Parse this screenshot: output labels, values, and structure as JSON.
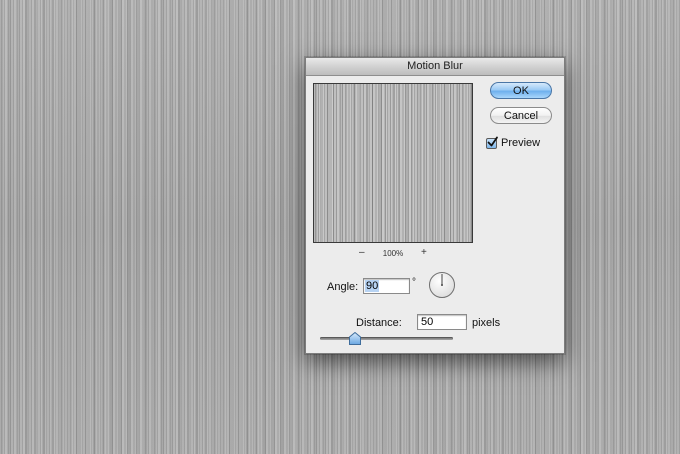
{
  "dialog": {
    "title": "Motion Blur",
    "ok_label": "OK",
    "cancel_label": "Cancel",
    "preview_label": "Preview",
    "preview_checked": true
  },
  "zoom": {
    "minus": "–",
    "level": "100%",
    "plus": "+"
  },
  "angle": {
    "label": "Angle:",
    "value": "90",
    "unit": "°"
  },
  "distance": {
    "label": "Distance:",
    "value": "50",
    "unit": "pixels",
    "slider_fraction": 0.26
  },
  "colors": {
    "ok_button_accent": "#6fb0ee",
    "dialog_background": "#ececec"
  },
  "icons": [
    "check-icon",
    "angle-dial-icon",
    "slider-thumb-icon"
  ]
}
